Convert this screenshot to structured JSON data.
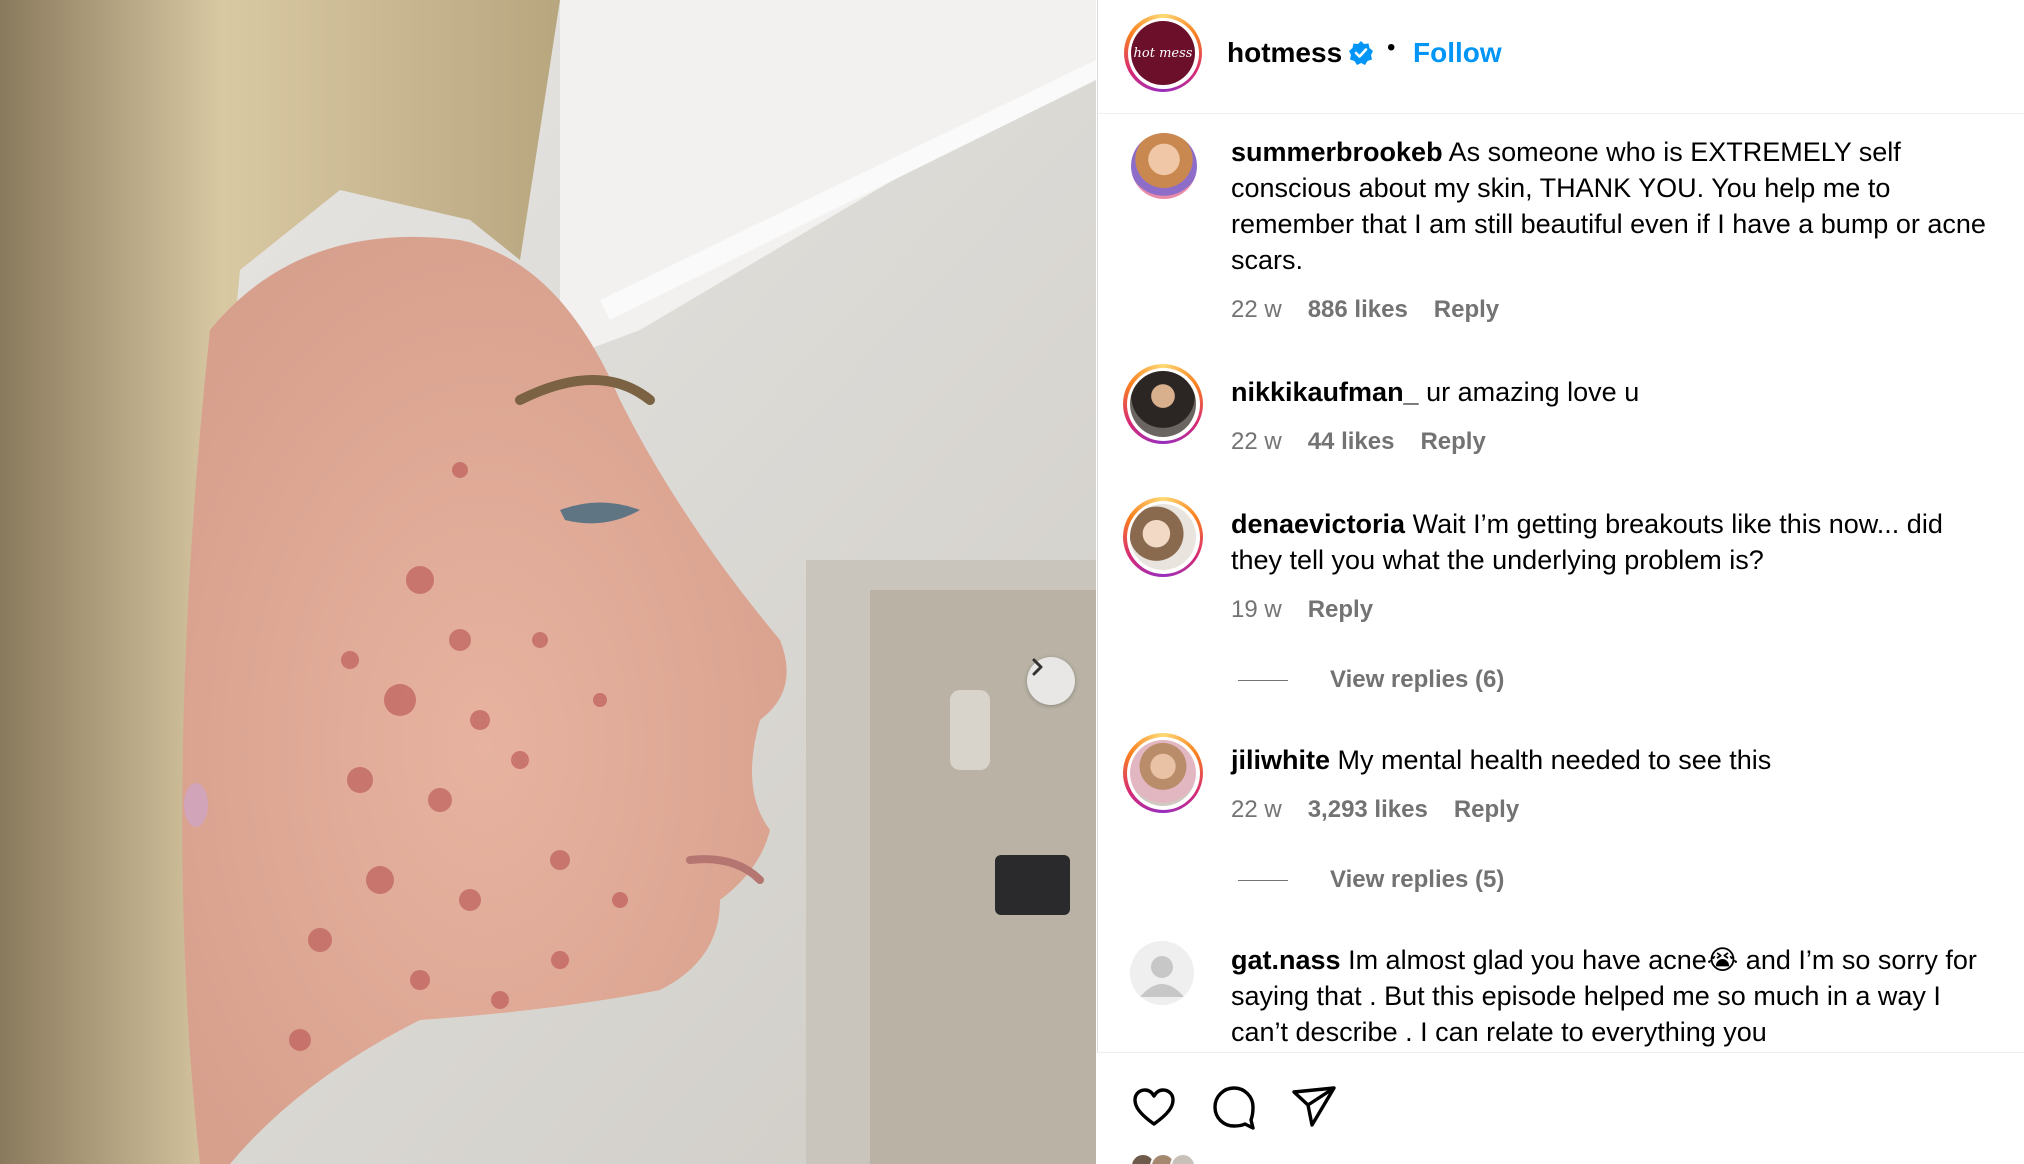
{
  "post": {
    "username": "hotmess",
    "logo_text": "hot mess",
    "follow_label": "Follow",
    "separator": "•",
    "accent": "#0095f6"
  },
  "comments": [
    {
      "username": "summerbrookeb",
      "text": "As someone who is EXTREMELY self conscious about my skin, THANK YOU. You help me to remember that I am still beautiful even if I have a bump or acne scars.",
      "age": "22 w",
      "likes": "886 likes",
      "reply": "Reply"
    },
    {
      "username": "nikkikaufman_",
      "text": "ur amazing love u",
      "age": "22 w",
      "likes": "44 likes",
      "reply": "Reply"
    },
    {
      "username": "denaevictoria",
      "text": "Wait I’m getting breakouts like this now... did they tell you what the underlying problem is?",
      "age": "19 w",
      "reply": "Reply",
      "view_replies": "View replies (6)"
    },
    {
      "username": "jiliwhite",
      "text": "My mental health needed to see this",
      "age": "22 w",
      "likes": "3,293 likes",
      "reply": "Reply",
      "view_replies": "View replies (5)"
    },
    {
      "username": "gat.nass",
      "text": "Im almost glad you have acne😭 and I’m so sorry for saying that . But this episode helped me so much in a way I can’t describe . I can relate to everything you"
    }
  ],
  "icons": [
    "chevron-right-icon",
    "verified-badge-icon",
    "heart-icon",
    "comment-icon",
    "share-icon",
    "default-avatar-icon"
  ]
}
